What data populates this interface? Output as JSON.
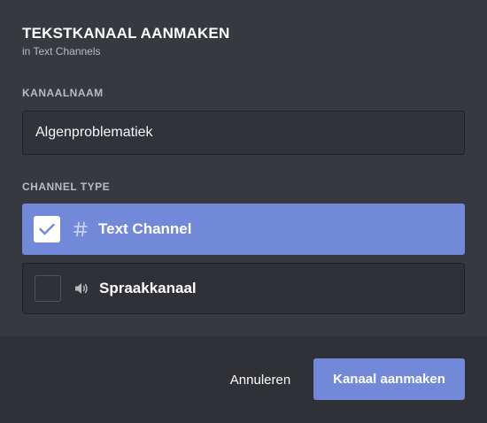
{
  "modal": {
    "title": "TEKSTKANAAL AANMAKEN",
    "subtitle": "in Text Channels"
  },
  "channel_name": {
    "label": "KANAALNAAM",
    "value": "Algenproblematiek"
  },
  "channel_type": {
    "label": "CHANNEL TYPE",
    "options": [
      {
        "label": "Text Channel",
        "icon": "hashtag-icon",
        "selected": true
      },
      {
        "label": "Spraakkanaal",
        "icon": "speaker-icon",
        "selected": false
      }
    ]
  },
  "footer": {
    "cancel_label": "Annuleren",
    "create_label": "Kanaal aanmaken"
  },
  "colors": {
    "accent": "#7289da",
    "background": "#36393f",
    "footer": "#2f3136"
  }
}
